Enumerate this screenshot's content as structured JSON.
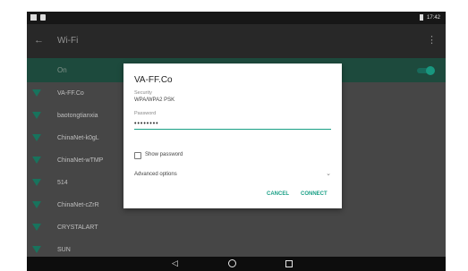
{
  "status_bar": {
    "time": "17:42",
    "left_icons": [
      "notification-icon",
      "lock-icon"
    ],
    "right_icons": [
      "battery-icon"
    ]
  },
  "app_bar": {
    "back_icon": "back-arrow-icon",
    "title": "Wi-Fi",
    "menu_icon": "more-vert-icon"
  },
  "toggle": {
    "label": "On",
    "state": "on"
  },
  "networks": [
    {
      "name": "VA-FF.Co"
    },
    {
      "name": "baotongtianxia"
    },
    {
      "name": "ChinaNet-k0gL"
    },
    {
      "name": "ChinaNet-wTMP"
    },
    {
      "name": "514"
    },
    {
      "name": "ChinaNet-cZrR"
    },
    {
      "name": "CRYSTALART"
    },
    {
      "name": "SUN"
    }
  ],
  "dialog": {
    "title": "VA-FF.Co",
    "security_label": "Security",
    "security_value": "WPA/WPA2 PSK",
    "password_label": "Password",
    "password_value": "••••••••",
    "show_password_label": "Show password",
    "advanced_label": "Advanced options",
    "cancel_label": "CANCEL",
    "connect_label": "CONNECT"
  },
  "nav_bar": {
    "back": "◁",
    "home": "home-icon",
    "recents": "recents-icon"
  },
  "colors": {
    "accent": "#1aa086",
    "wifi_icon": "#1a7a62",
    "onbar_bg": "#1f4f41"
  }
}
